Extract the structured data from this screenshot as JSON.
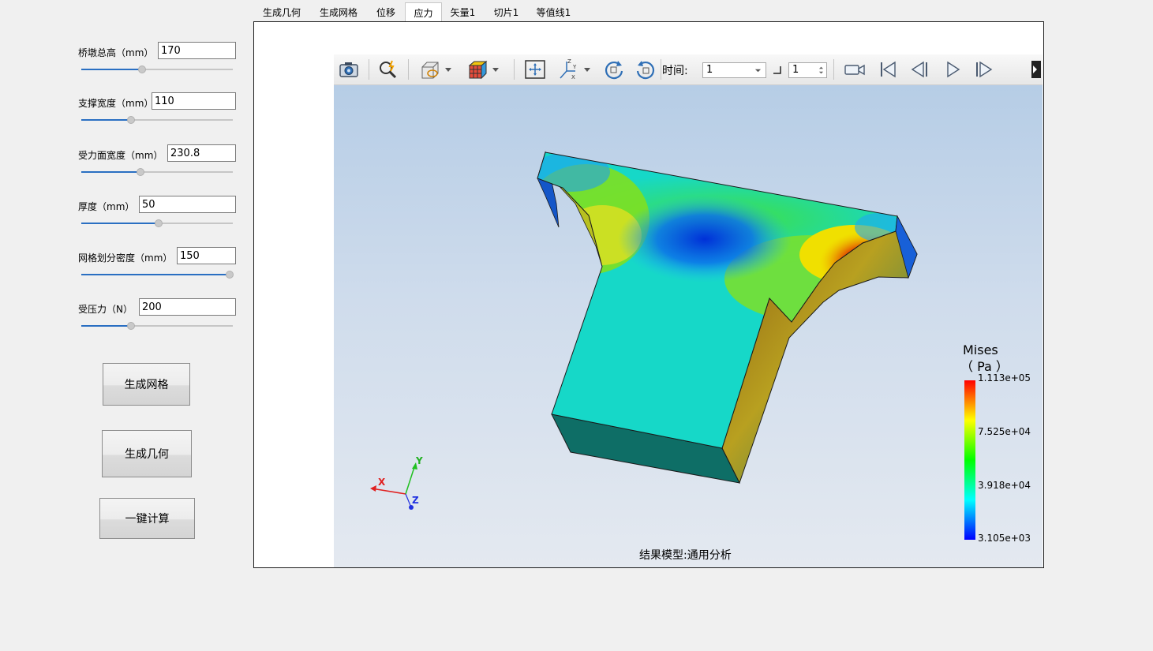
{
  "params": [
    {
      "label": "桥墩总高（mm）",
      "value": "170",
      "slider": 0.4
    },
    {
      "label": "支撑宽度（mm）",
      "value": "110",
      "slider": 0.33
    },
    {
      "label": "受力面宽度（mm）",
      "value": "230.8",
      "slider": 0.39
    },
    {
      "label": "厚度（mm）",
      "value": "50",
      "slider": 0.51
    },
    {
      "label": "网格划分密度（mm）",
      "value": "150",
      "slider": 0.98
    },
    {
      "label": "受压力（N）",
      "value": "200",
      "slider": 0.33
    }
  ],
  "buttons": {
    "mesh": "生成网格",
    "geometry": "生成几何",
    "compute": "一键计算"
  },
  "tabs": [
    "生成几何",
    "生成网格",
    "位移",
    "应力",
    "矢量1",
    "切片1",
    "等值线1"
  ],
  "active_tab": "应力",
  "toolbar": {
    "time_label": "时间:",
    "time_value": "1",
    "step_value": "1"
  },
  "legend": {
    "title": "Mises",
    "unit": "（ Pa ）",
    "max": "1.113e+05",
    "mid_high": "7.525e+04",
    "mid_low": "3.918e+04",
    "min": "3.105e+03",
    "colors": [
      "#ff0000",
      "#ffff00",
      "#00ff00",
      "#00ffff",
      "#0000ff"
    ]
  },
  "axes": {
    "x": "X",
    "y": "Y",
    "z": "Z"
  },
  "footer": "结果模型:通用分析"
}
